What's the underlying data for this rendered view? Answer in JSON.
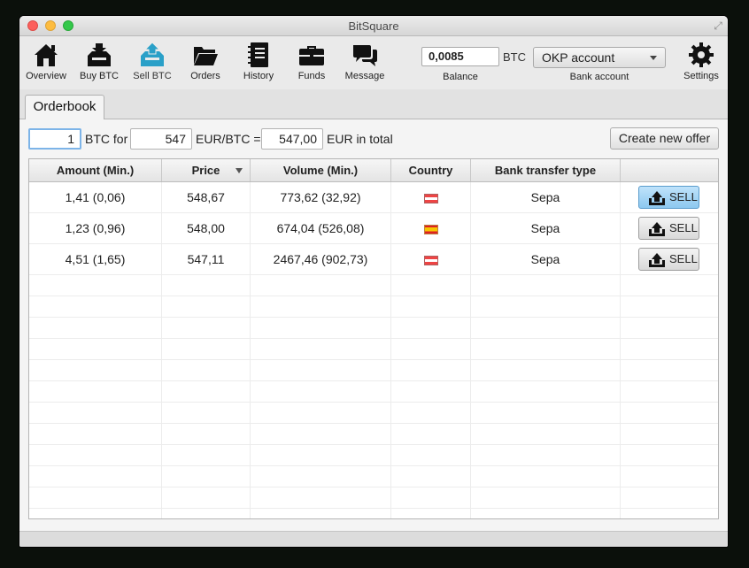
{
  "window": {
    "title": "BitSquare"
  },
  "toolbar": {
    "items": [
      {
        "label": "Overview",
        "icon": "home-icon"
      },
      {
        "label": "Buy BTC",
        "icon": "buy-btc-icon"
      },
      {
        "label": "Sell BTC",
        "icon": "sell-btc-icon",
        "active": true,
        "accent": "#2aa0c8"
      },
      {
        "label": "Orders",
        "icon": "folder-icon"
      },
      {
        "label": "History",
        "icon": "notebook-icon"
      },
      {
        "label": "Funds",
        "icon": "briefcase-icon"
      },
      {
        "label": "Message",
        "icon": "chat-icon"
      },
      {
        "label": "Settings",
        "icon": "gear-icon"
      }
    ],
    "balance": {
      "value": "0,0085",
      "unit": "BTC",
      "label": "Balance"
    },
    "bank_account": {
      "selected": "OKP account",
      "label": "Bank account"
    }
  },
  "tabs": [
    {
      "label": "Orderbook"
    }
  ],
  "filter": {
    "amount": "1",
    "amount_suffix": "BTC for",
    "price": "547",
    "price_suffix": "EUR/BTC =",
    "total": "547,00",
    "total_suffix": "EUR in total",
    "create_button": "Create new offer"
  },
  "table": {
    "columns": [
      "Amount (Min.)",
      "Price",
      "Volume (Min.)",
      "Country",
      "Bank transfer type",
      ""
    ],
    "sorted_column": "Price",
    "rows": [
      {
        "amount": "1,41 (0,06)",
        "price": "548,67",
        "volume": "773,62 (32,92)",
        "country_flag": "austria-flag-icon",
        "bank_type": "Sepa",
        "action": "SELL",
        "action_active": true
      },
      {
        "amount": "1,23 (0,96)",
        "price": "548,00",
        "volume": "674,04 (526,08)",
        "country_flag": "spain-flag-icon",
        "bank_type": "Sepa",
        "action": "SELL",
        "action_active": false
      },
      {
        "amount": "4,51 (1,65)",
        "price": "547,11",
        "volume": "2467,46 (902,73)",
        "country_flag": "austria-flag-icon",
        "bank_type": "Sepa",
        "action": "SELL",
        "action_active": false
      }
    ]
  },
  "colors": {
    "accent": "#2aa0c8",
    "selected_button": "#a8d6f5",
    "focus_ring": "#7db4e8"
  }
}
